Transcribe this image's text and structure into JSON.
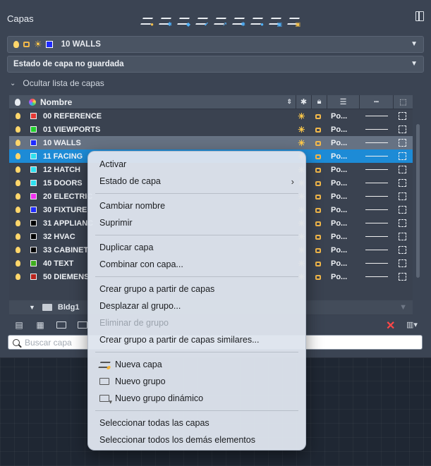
{
  "panel": {
    "title": "Capas",
    "current_layer": {
      "name": "10 WALLS",
      "color": "#1f2bff"
    },
    "layer_state": "Estado de capa no guardada",
    "collapse_label": "Ocultar lista de capas",
    "columns": {
      "name": "Nombre",
      "transparency_value": "Po..."
    },
    "rows": [
      {
        "name": "00 REFERENCE",
        "color": "#e53935",
        "state": "normal"
      },
      {
        "name": "01 VIEWPORTS",
        "color": "#22d12e",
        "state": "normal"
      },
      {
        "name": "10 WALLS",
        "color": "#1f2bff",
        "state": "current"
      },
      {
        "name": "11 FACING",
        "color": "#2ee0ef",
        "state": "selected"
      },
      {
        "name": "12 HATCH",
        "color": "#2ee0ef",
        "state": "normal"
      },
      {
        "name": "15 DOORS",
        "color": "#2ee0ef",
        "state": "normal"
      },
      {
        "name": "20 ELECTRIC",
        "color": "#f02ff0",
        "state": "normal"
      },
      {
        "name": "30 FIXTURE",
        "color": "#1f2bff",
        "state": "normal"
      },
      {
        "name": "31 APPLIANC",
        "color": "#000000",
        "state": "normal"
      },
      {
        "name": "32 HVAC",
        "color": "#000000",
        "state": "normal"
      },
      {
        "name": "33 CABINET",
        "color": "#000000",
        "state": "normal"
      },
      {
        "name": "40 TEXT",
        "color": "#3fae1f",
        "state": "normal"
      },
      {
        "name": "50 DIEMENS",
        "color": "#b8231c",
        "state": "normal"
      }
    ],
    "group": {
      "name": "Bldg1"
    },
    "search_placeholder": "Buscar capa"
  },
  "context_menu": {
    "items": [
      {
        "label": "Activar"
      },
      {
        "label": "Estado de capa",
        "submenu": true
      },
      {
        "label": "Cambiar nombre"
      },
      {
        "label": "Suprimir"
      },
      {
        "label": "Duplicar capa"
      },
      {
        "label": "Combinar con capa..."
      },
      {
        "label": "Crear grupo a partir de capas"
      },
      {
        "label": "Desplazar al grupo..."
      },
      {
        "label": "Eliminar de grupo",
        "disabled": true
      },
      {
        "label": "Crear grupo a partir de capas similares..."
      },
      {
        "label": "Nueva capa",
        "icon": "new-layer-icon"
      },
      {
        "label": "Nuevo grupo",
        "icon": "folder-icon"
      },
      {
        "label": "Nuevo grupo dinámico",
        "icon": "dynamic-group-icon"
      },
      {
        "label": "Seleccionar todas las capas"
      },
      {
        "label": "Seleccionar todos los demás elementos"
      }
    ]
  },
  "colors": {
    "selection": "#1d8bd6",
    "current_row": "#667283",
    "panel_bg": "#3b4453",
    "danger": "#ff4747"
  }
}
